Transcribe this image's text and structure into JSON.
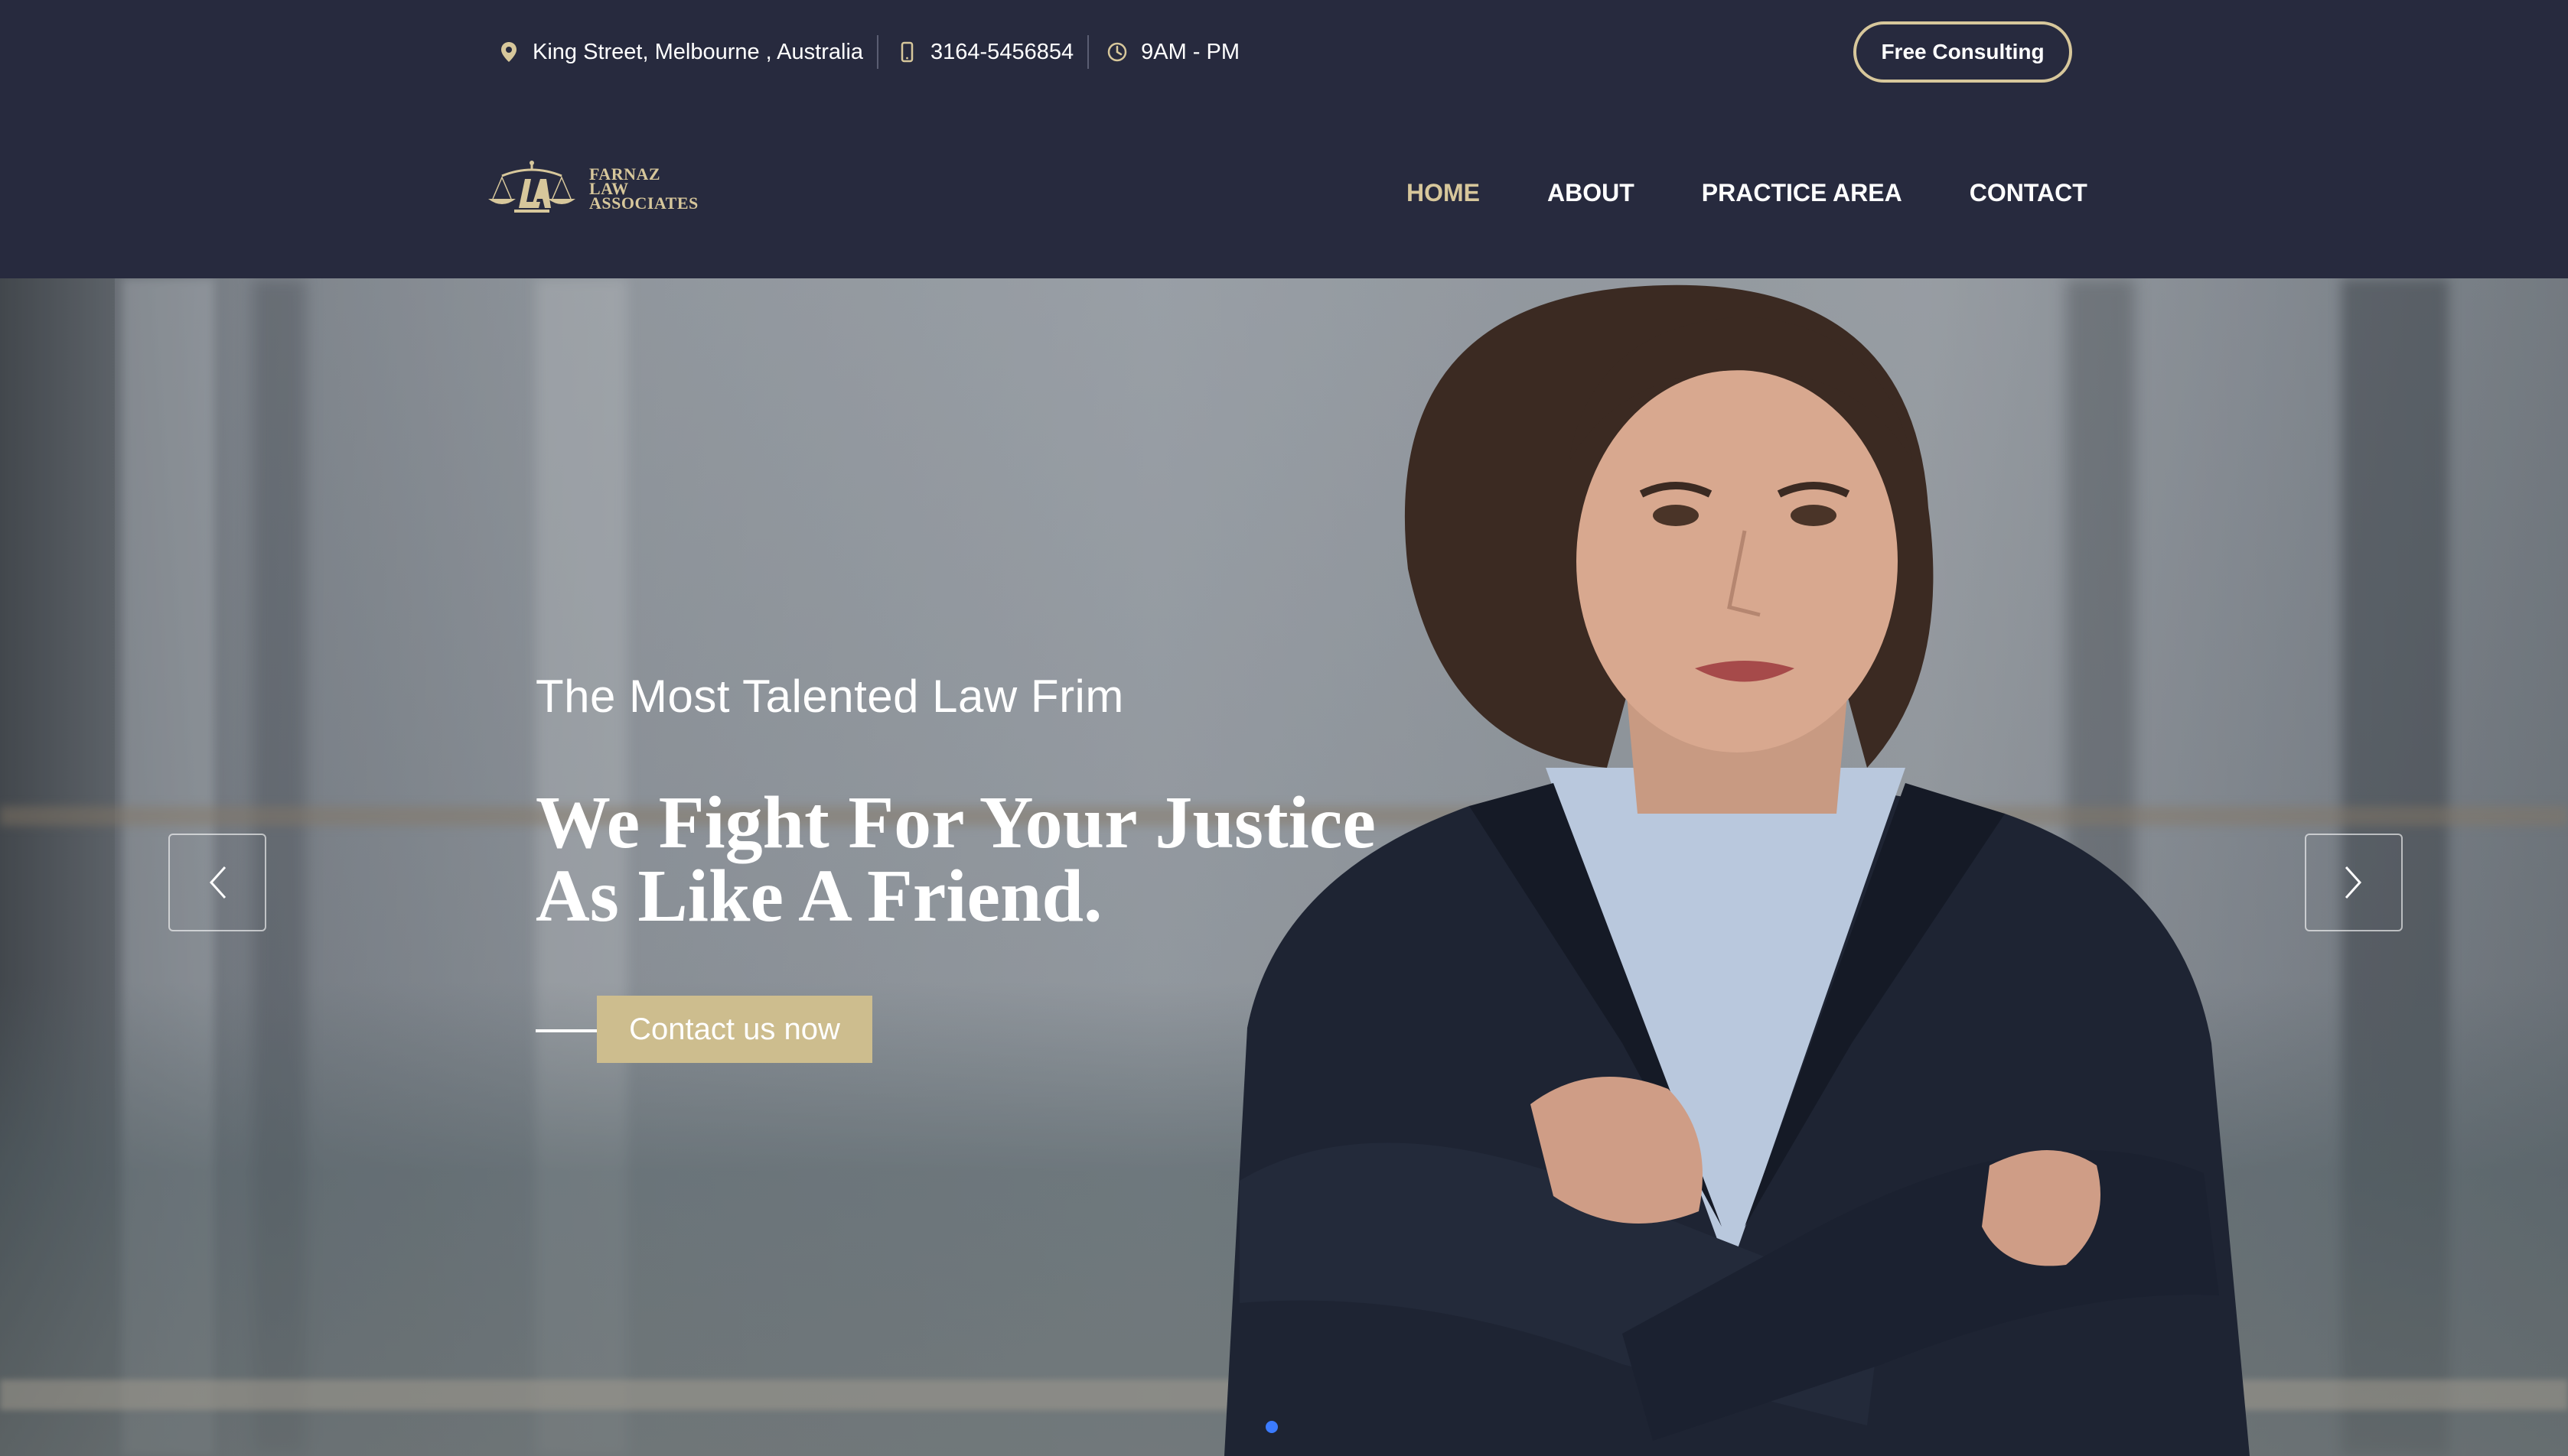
{
  "topbar": {
    "address": "King Street, Melbourne , Australia",
    "phone": "3164-5456854",
    "hours": "9AM - PM",
    "consult_label": "Free Consulting",
    "icons": [
      "location-pin-icon",
      "phone-icon",
      "clock-icon"
    ]
  },
  "logo": {
    "line1": "FARNAZ",
    "line2": "LAW",
    "line3": "ASSOCIATES"
  },
  "nav": {
    "items": [
      {
        "label": "HOME",
        "active": true
      },
      {
        "label": "ABOUT",
        "active": false
      },
      {
        "label": "PRACTICE AREA",
        "active": false
      },
      {
        "label": "CONTACT",
        "active": false
      }
    ]
  },
  "hero": {
    "subtitle": "The Most Talented Law Frim",
    "title_line1": "We Fight For Your Justice",
    "title_line2": "As Like A Friend.",
    "cta_label": "Contact us now",
    "slide_count_visible": 1
  },
  "colors": {
    "header_bg": "#272a3e",
    "accent_gold": "#d7c79b",
    "cta_bg": "#cdbd8e",
    "dot_active": "#3b7bff"
  }
}
